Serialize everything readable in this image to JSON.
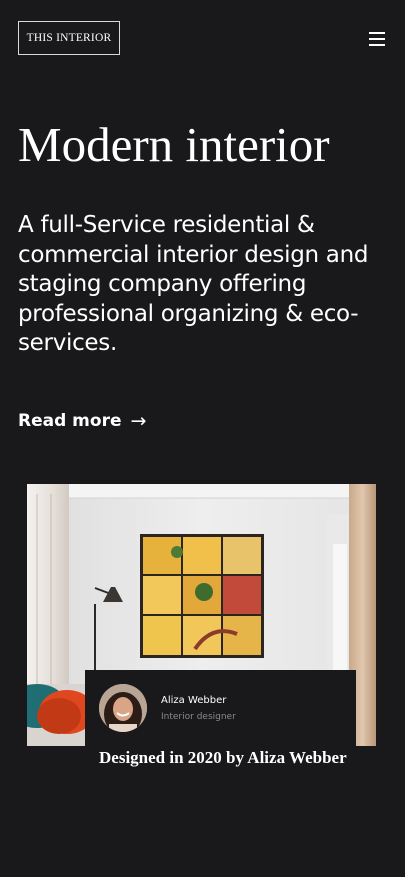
{
  "header": {
    "logo_text": "THIS INTERIOR",
    "menu_icon": "hamburger-menu-icon"
  },
  "hero": {
    "title": "Modern interior",
    "description": "A full-Service residential & commercial interior design and staging company offering professional organizing & eco-services.",
    "read_more_label": "Read more",
    "read_more_arrow": "→",
    "image_icon": "living-room-photo"
  },
  "card": {
    "author_name": "Aliza Webber",
    "author_role": "Interior designer",
    "avatar_icon": "author-avatar",
    "title": "Designed in 2020 by Aliza Webber"
  },
  "colors": {
    "background": "#19191b",
    "text": "#ffffff",
    "muted_text": "#8a8a8c",
    "border": "#d9d9d9"
  }
}
